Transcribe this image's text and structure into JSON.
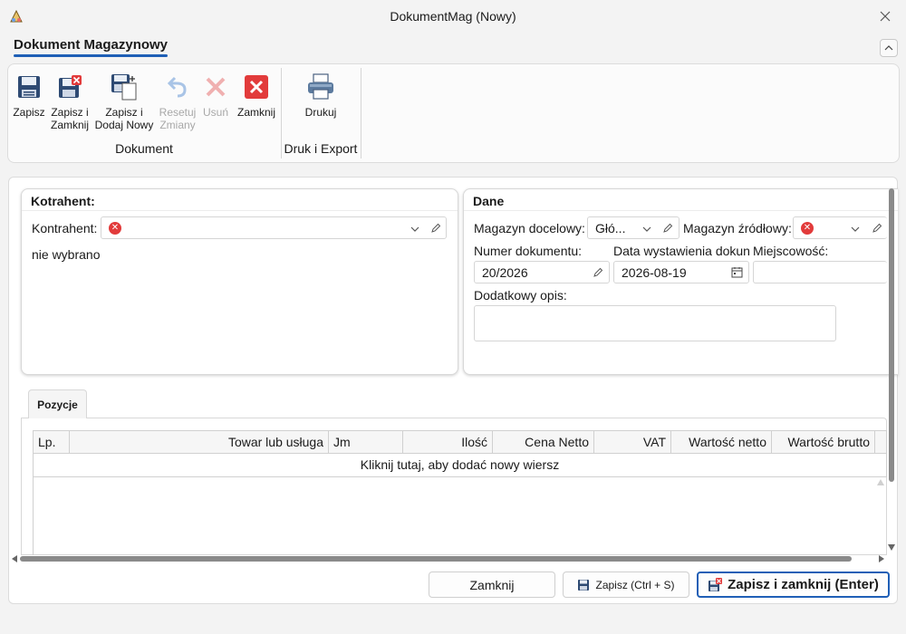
{
  "window": {
    "title": "DokumentMag (Nowy)"
  },
  "ribbon": {
    "tab_label": "Dokument Magazynowy",
    "groups": {
      "dokument": {
        "label": "Dokument",
        "buttons": {
          "save": {
            "label": "Zapisz"
          },
          "save_close": {
            "line1": "Zapisz i",
            "line2": "Zamknij"
          },
          "save_add_new": {
            "line1": "Zapisz i",
            "line2": "Dodaj Nowy"
          },
          "reset": {
            "line1": "Resetuj",
            "line2": "Zmiany",
            "disabled": true
          },
          "delete": {
            "label": "Usuń",
            "disabled": true
          },
          "close": {
            "label": "Zamknij"
          }
        }
      },
      "druk": {
        "label": "Druk i Export",
        "buttons": {
          "print": {
            "label": "Drukuj"
          }
        }
      }
    }
  },
  "kontrahent_card": {
    "title": "Kotrahent:",
    "field_label": "Kontrahent:",
    "status_text": "nie wybrano"
  },
  "dane_card": {
    "title": "Dane",
    "magazyn_docelowy": {
      "label": "Magazyn docelowy:",
      "value": "Głó..."
    },
    "magazyn_zrodlowy": {
      "label": "Magazyn źródłowy:",
      "value": ""
    },
    "numer_dokumentu": {
      "label": "Numer dokumentu:",
      "value": "20/2026"
    },
    "data_wystawienia": {
      "label": "Data wystawienia dokun",
      "value": "2026-08-19"
    },
    "miejscowosc": {
      "label": "Miejscowość:",
      "value": ""
    },
    "dodatkowy_opis": {
      "label": "Dodatkowy opis:",
      "value": ""
    }
  },
  "tabs": {
    "pozycje": {
      "label": "Pozycje"
    }
  },
  "grid": {
    "columns": [
      "Lp.",
      "Towar lub usługa",
      "Jm",
      "Ilość",
      "Cena Netto",
      "VAT",
      "Wartość netto",
      "Wartość brutto"
    ],
    "new_row_hint": "Kliknij tutaj, aby dodać nowy wiersz"
  },
  "footer": {
    "close_label": "Zamknij",
    "save_label": "Zapisz (Ctrl + S)",
    "save_close_label": "Zapisz i zamknij (Enter)"
  },
  "colors": {
    "accent": "#1f5fb6",
    "error": "#e23b3b",
    "save_icon": "#2e4a73"
  }
}
